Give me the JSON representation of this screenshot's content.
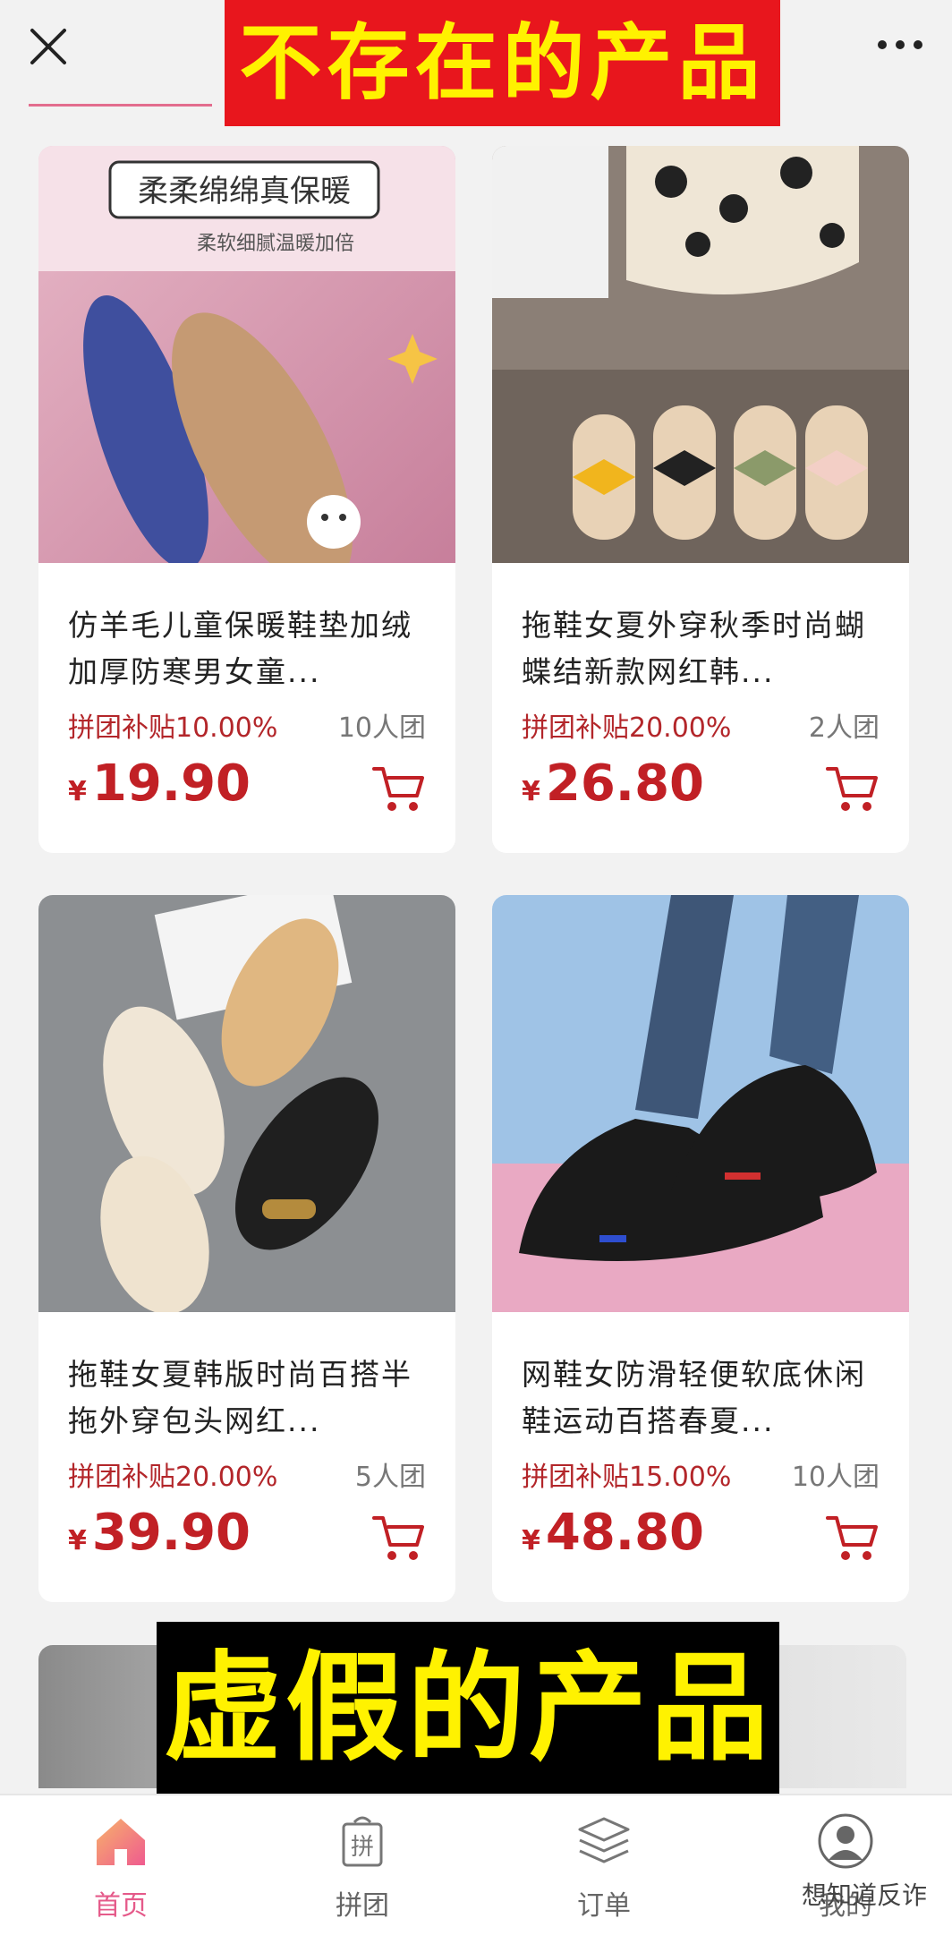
{
  "topbar": {
    "banner": "不存在的产品"
  },
  "products": [
    {
      "title": "仿羊毛儿童保暖鞋垫加绒加厚防寒男女童...",
      "subsidy": "拼团补贴10.00%",
      "group": "10人团",
      "currency": "¥",
      "price": "19.90",
      "image_caption": "柔柔绵绵真保暖",
      "image_subcaption": "柔软细腻温暖加倍"
    },
    {
      "title": "拖鞋女夏外穿秋季时尚蝴蝶结新款网红韩...",
      "subsidy": "拼团补贴20.00%",
      "group": "2人团",
      "currency": "¥",
      "price": "26.80"
    },
    {
      "title": "拖鞋女夏韩版时尚百搭半拖外穿包头网红...",
      "subsidy": "拼团补贴20.00%",
      "group": "5人团",
      "currency": "¥",
      "price": "39.90"
    },
    {
      "title": "网鞋女防滑轻便软底休闲鞋运动百搭春夏...",
      "subsidy": "拼团补贴15.00%",
      "group": "10人团",
      "currency": "¥",
      "price": "48.80"
    }
  ],
  "banner_bottom": "虚假的产品",
  "nav": [
    {
      "label": "首页",
      "icon": "home-icon",
      "active": true
    },
    {
      "label": "拼团",
      "icon": "group-buy-icon",
      "icon_text": "拼",
      "active": false
    },
    {
      "label": "订单",
      "icon": "orders-icon",
      "active": false
    },
    {
      "label": "我的",
      "icon": "profile-icon",
      "active": false
    }
  ],
  "watermark": "想知道反诈",
  "colors": {
    "price": "#c12025",
    "accent": "#e55a8a",
    "banner_top_bg": "#e8161d",
    "banner_text": "#fff200"
  }
}
